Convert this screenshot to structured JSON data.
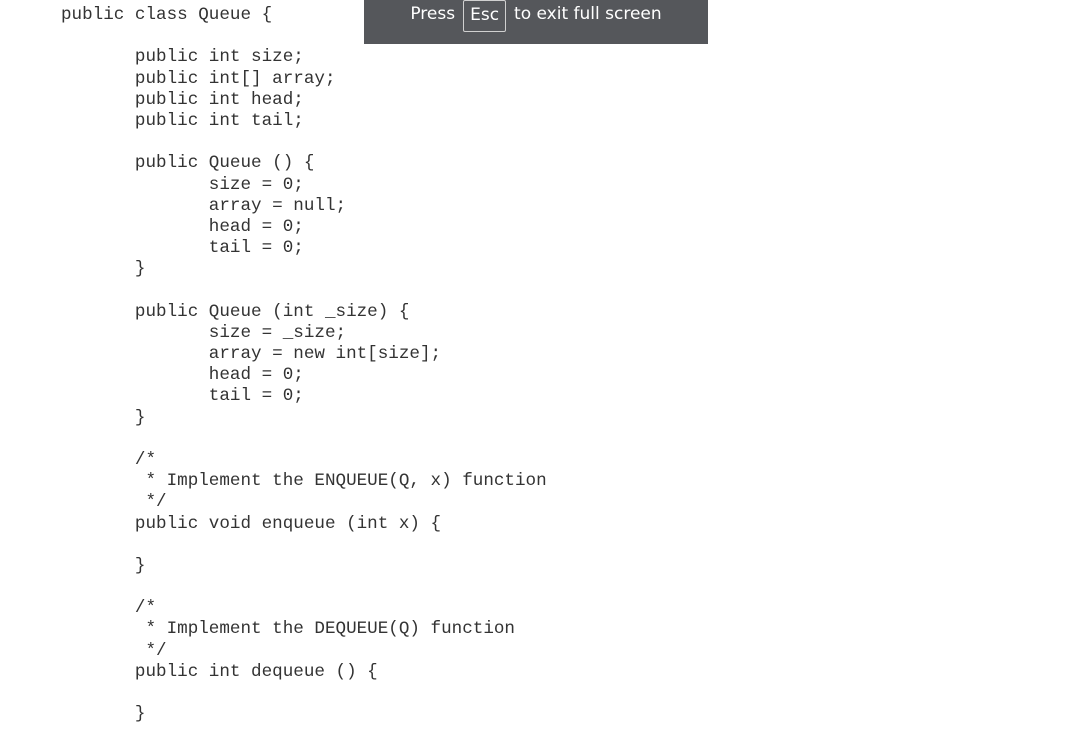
{
  "code_lines": [
    "public class Queue {",
    "",
    "       public int size;",
    "       public int[] array;",
    "       public int head;",
    "       public int tail;",
    "",
    "       public Queue () {",
    "              size = 0;",
    "              array = null;",
    "              head = 0;",
    "              tail = 0;",
    "       }",
    "",
    "       public Queue (int _size) {",
    "              size = _size;",
    "              array = new int[size];",
    "              head = 0;",
    "              tail = 0;",
    "       }",
    "",
    "       /*",
    "        * Implement the ENQUEUE(Q, x) function",
    "        */",
    "       public void enqueue (int x) {",
    "",
    "       }",
    "",
    "       /*",
    "        * Implement the DEQUEUE(Q) function",
    "        */",
    "       public int dequeue () {",
    "",
    "       }"
  ],
  "fullscreen_notice": {
    "prefix": "Press",
    "key": "Esc",
    "suffix": "to exit full screen"
  }
}
